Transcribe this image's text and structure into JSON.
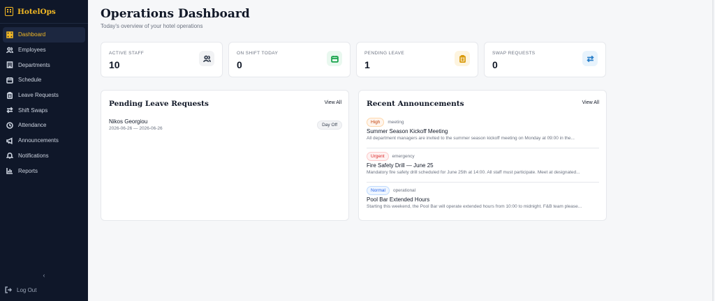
{
  "app": {
    "name": "HotelOps",
    "accent": "#f2b824"
  },
  "sidebar": {
    "items": [
      {
        "label": "Dashboard",
        "icon": "grid-icon",
        "active": true
      },
      {
        "label": "Employees",
        "icon": "users-icon"
      },
      {
        "label": "Departments",
        "icon": "building-icon"
      },
      {
        "label": "Schedule",
        "icon": "calendar-icon"
      },
      {
        "label": "Leave Requests",
        "icon": "clipboard-icon"
      },
      {
        "label": "Shift Swaps",
        "icon": "swap-icon"
      },
      {
        "label": "Attendance",
        "icon": "clock-icon"
      },
      {
        "label": "Announcements",
        "icon": "megaphone-icon"
      },
      {
        "label": "Notifications",
        "icon": "bell-icon"
      },
      {
        "label": "Reports",
        "icon": "bar-chart-icon"
      }
    ],
    "collapse_glyph": "‹",
    "logout_label": "Log Out"
  },
  "header": {
    "title": "Operations Dashboard",
    "subtitle": "Today's overview of your hotel operations"
  },
  "stats": [
    {
      "label": "ACTIVE STAFF",
      "value": "10",
      "icon": "users-icon",
      "color": "#374151",
      "bg": "#f1f2f4"
    },
    {
      "label": "ON SHIFT TODAY",
      "value": "0",
      "icon": "calendar-icon",
      "color": "#16a34a",
      "bg": "#e9f8ef"
    },
    {
      "label": "PENDING LEAVE",
      "value": "1",
      "icon": "clipboard-icon",
      "color": "#d99a0b",
      "bg": "#fdf4df"
    },
    {
      "label": "SWAP REQUESTS",
      "value": "0",
      "icon": "swap-icon",
      "color": "#2a7fc9",
      "bg": "#e8f3fc"
    }
  ],
  "leave_panel": {
    "title": "Pending Leave Requests",
    "view_all": "View All",
    "items": [
      {
        "name": "Nikos Georgiou",
        "dates": "2026-06-26 — 2026-06-26",
        "type": "Day Off"
      }
    ]
  },
  "announcements_panel": {
    "title": "Recent Announcements",
    "view_all": "View All",
    "items": [
      {
        "priority": "High",
        "priority_color": "#c2410c",
        "priority_bg": "#fff5ed",
        "priority_border": "#fed7aa",
        "category": "meeting",
        "title": "Summer Season Kickoff Meeting",
        "body": "All department managers are invited to the summer season kickoff meeting on Monday at 09:00 in the..."
      },
      {
        "priority": "Urgent",
        "priority_color": "#dc2626",
        "priority_bg": "#fef2f2",
        "priority_border": "#fecaca",
        "category": "emergency",
        "title": "Fire Safety Drill — June 25",
        "body": "Mandatory fire safety drill scheduled for June 25th at 14:00. All staff must participate. Meet at designated..."
      },
      {
        "priority": "Normal",
        "priority_color": "#2563eb",
        "priority_bg": "#eff6ff",
        "priority_border": "#bfdbfe",
        "category": "operational",
        "title": "Pool Bar Extended Hours",
        "body": "Starting this weekend, the Pool Bar will operate extended hours from 10:00 to midnight. F&B team please..."
      }
    ]
  }
}
